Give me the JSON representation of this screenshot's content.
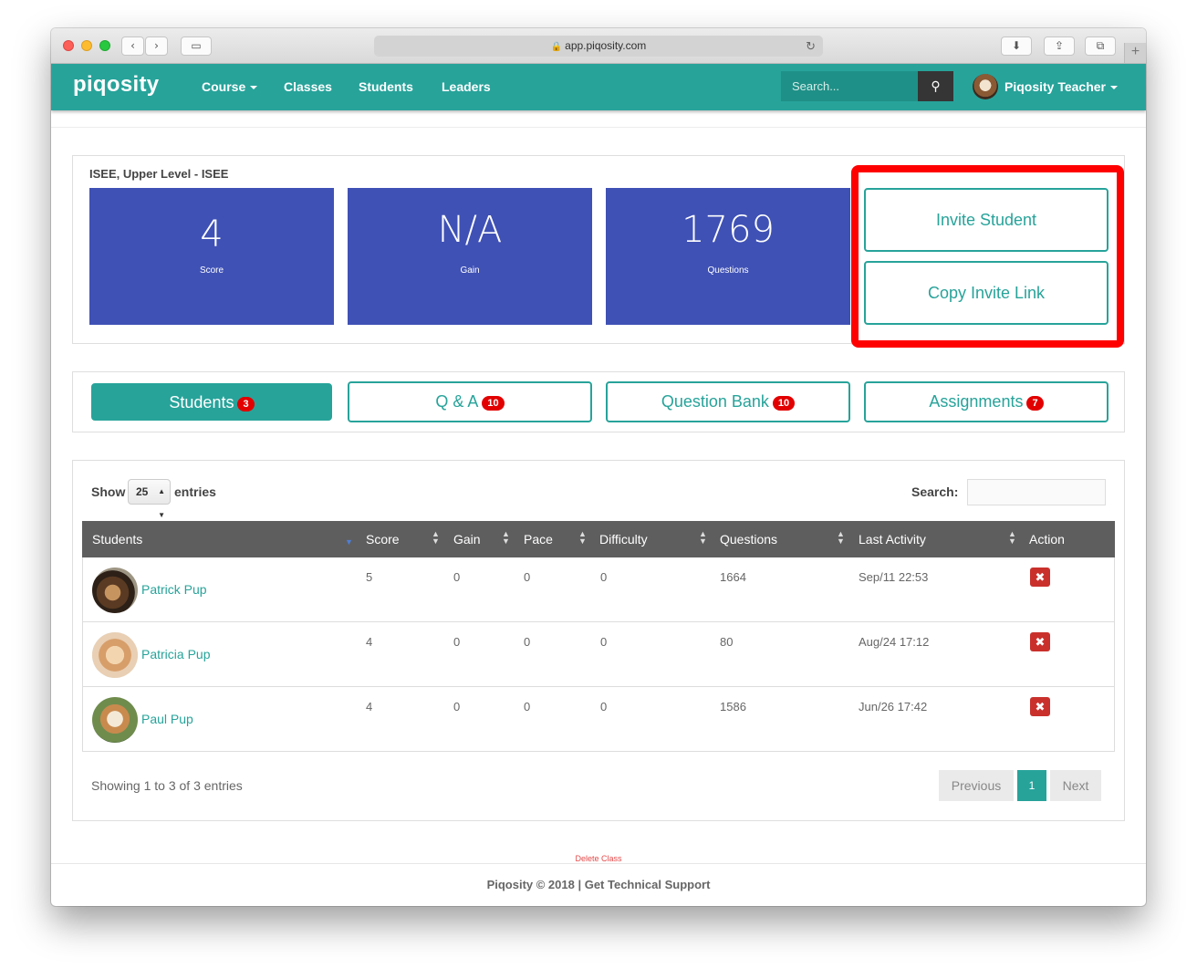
{
  "browser": {
    "url": "app.piqosity.com",
    "back_icon": "chevron-left-icon",
    "forward_icon": "chevron-right-icon"
  },
  "navbar": {
    "brand": "piqosity",
    "items": [
      {
        "label": "Course"
      },
      {
        "label": "Classes"
      },
      {
        "label": "Students"
      },
      {
        "label": "Leaders"
      }
    ],
    "search_placeholder": "Search...",
    "user_name": "Piqosity Teacher",
    "color": "#27a39a"
  },
  "course": {
    "title": "ISEE, Upper Level - ISEE",
    "stats": [
      {
        "value": "4",
        "label": "Score"
      },
      {
        "value": "N/A",
        "label": "Gain"
      },
      {
        "value": "1769",
        "label": "Questions"
      }
    ],
    "stat_color": "#3f51b5"
  },
  "actions": {
    "invite_student": "Invite Student",
    "copy_invite_link": "Copy Invite Link",
    "highlight_color": "#ff0000"
  },
  "tabs": [
    {
      "label": "Students",
      "count": "3"
    },
    {
      "label": "Q & A",
      "count": "10"
    },
    {
      "label": "Question Bank",
      "count": "10"
    },
    {
      "label": "Assignments",
      "count": "7"
    }
  ],
  "table": {
    "show_label": "Show",
    "length_value": "25",
    "entries_label": "entries",
    "search_label": "Search:",
    "columns": [
      "Students",
      "Score",
      "Gain",
      "Pace",
      "Difficulty",
      "Questions",
      "Last Activity",
      "Action"
    ],
    "rows": [
      {
        "name": "Patrick Pup",
        "score": "5",
        "gain": "0",
        "pace": "0",
        "difficulty": "0",
        "questions": "1664",
        "last_activity": "Sep/11 22:53"
      },
      {
        "name": "Patricia Pup",
        "score": "4",
        "gain": "0",
        "pace": "0",
        "difficulty": "0",
        "questions": "80",
        "last_activity": "Aug/24 17:12"
      },
      {
        "name": "Paul Pup",
        "score": "4",
        "gain": "0",
        "pace": "0",
        "difficulty": "0",
        "questions": "1586",
        "last_activity": "Jun/26 17:42"
      }
    ],
    "info": "Showing 1 to 3 of 3 entries",
    "pagination": {
      "previous": "Previous",
      "current": "1",
      "next": "Next"
    }
  },
  "footer": {
    "delete_class": "Delete Class",
    "text": "Piqosity © 2018 | Get Technical Support"
  }
}
